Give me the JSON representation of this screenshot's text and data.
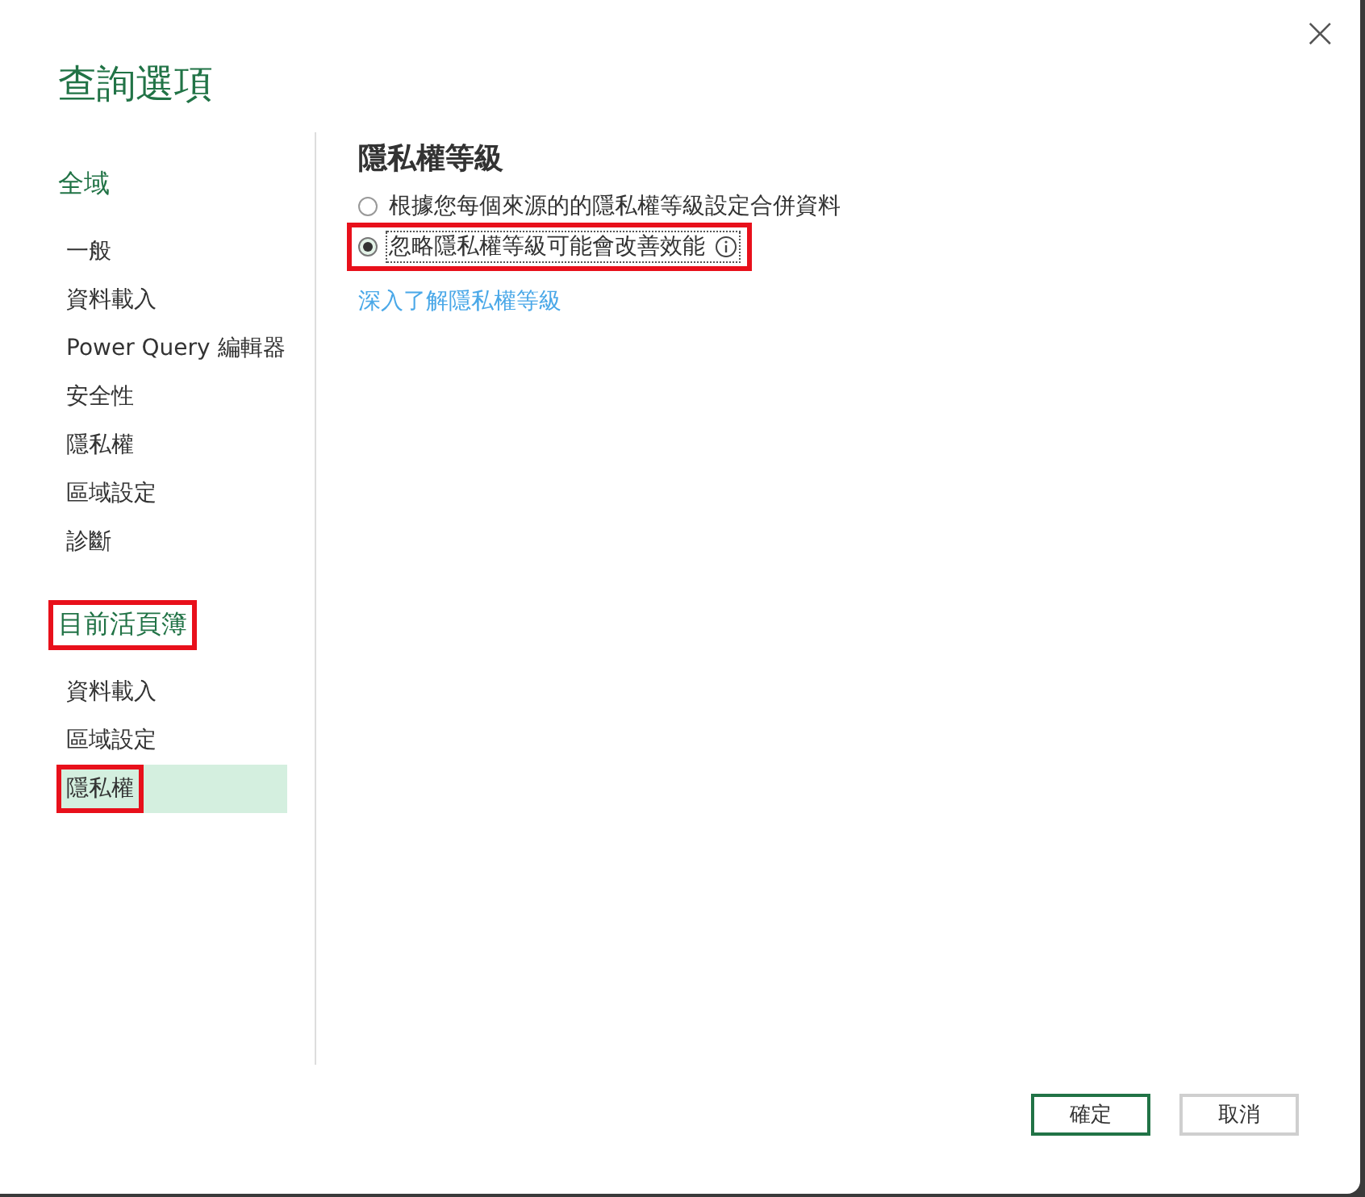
{
  "window": {
    "title": "查詢選項",
    "close_icon": "×"
  },
  "sidebar": {
    "sections": [
      {
        "heading": "全域",
        "highlighted": false,
        "items": [
          {
            "label": "一般",
            "selected": false,
            "highlighted": false
          },
          {
            "label": "資料載入",
            "selected": false,
            "highlighted": false
          },
          {
            "label": "Power Query 編輯器",
            "selected": false,
            "highlighted": false
          },
          {
            "label": "安全性",
            "selected": false,
            "highlighted": false
          },
          {
            "label": "隱私權",
            "selected": false,
            "highlighted": false
          },
          {
            "label": "區域設定",
            "selected": false,
            "highlighted": false
          },
          {
            "label": "診斷",
            "selected": false,
            "highlighted": false
          }
        ]
      },
      {
        "heading": "目前活頁簿",
        "highlighted": true,
        "items": [
          {
            "label": "資料載入",
            "selected": false,
            "highlighted": false
          },
          {
            "label": "區域設定",
            "selected": false,
            "highlighted": false
          },
          {
            "label": "隱私權",
            "selected": true,
            "highlighted": true
          }
        ]
      }
    ]
  },
  "content": {
    "heading": "隱私權等級",
    "options": [
      {
        "label": "根據您每個來源的的隱私權等級設定合併資料",
        "selected": false,
        "focused": false,
        "info": false,
        "highlighted": false
      },
      {
        "label": "忽略隱私權等級可能會改善效能",
        "selected": true,
        "focused": true,
        "info": true,
        "highlighted": true
      }
    ],
    "link": "深入了解隱私權等級"
  },
  "buttons": [
    {
      "label": "確定",
      "default": true
    },
    {
      "label": "取消",
      "default": false
    }
  ]
}
